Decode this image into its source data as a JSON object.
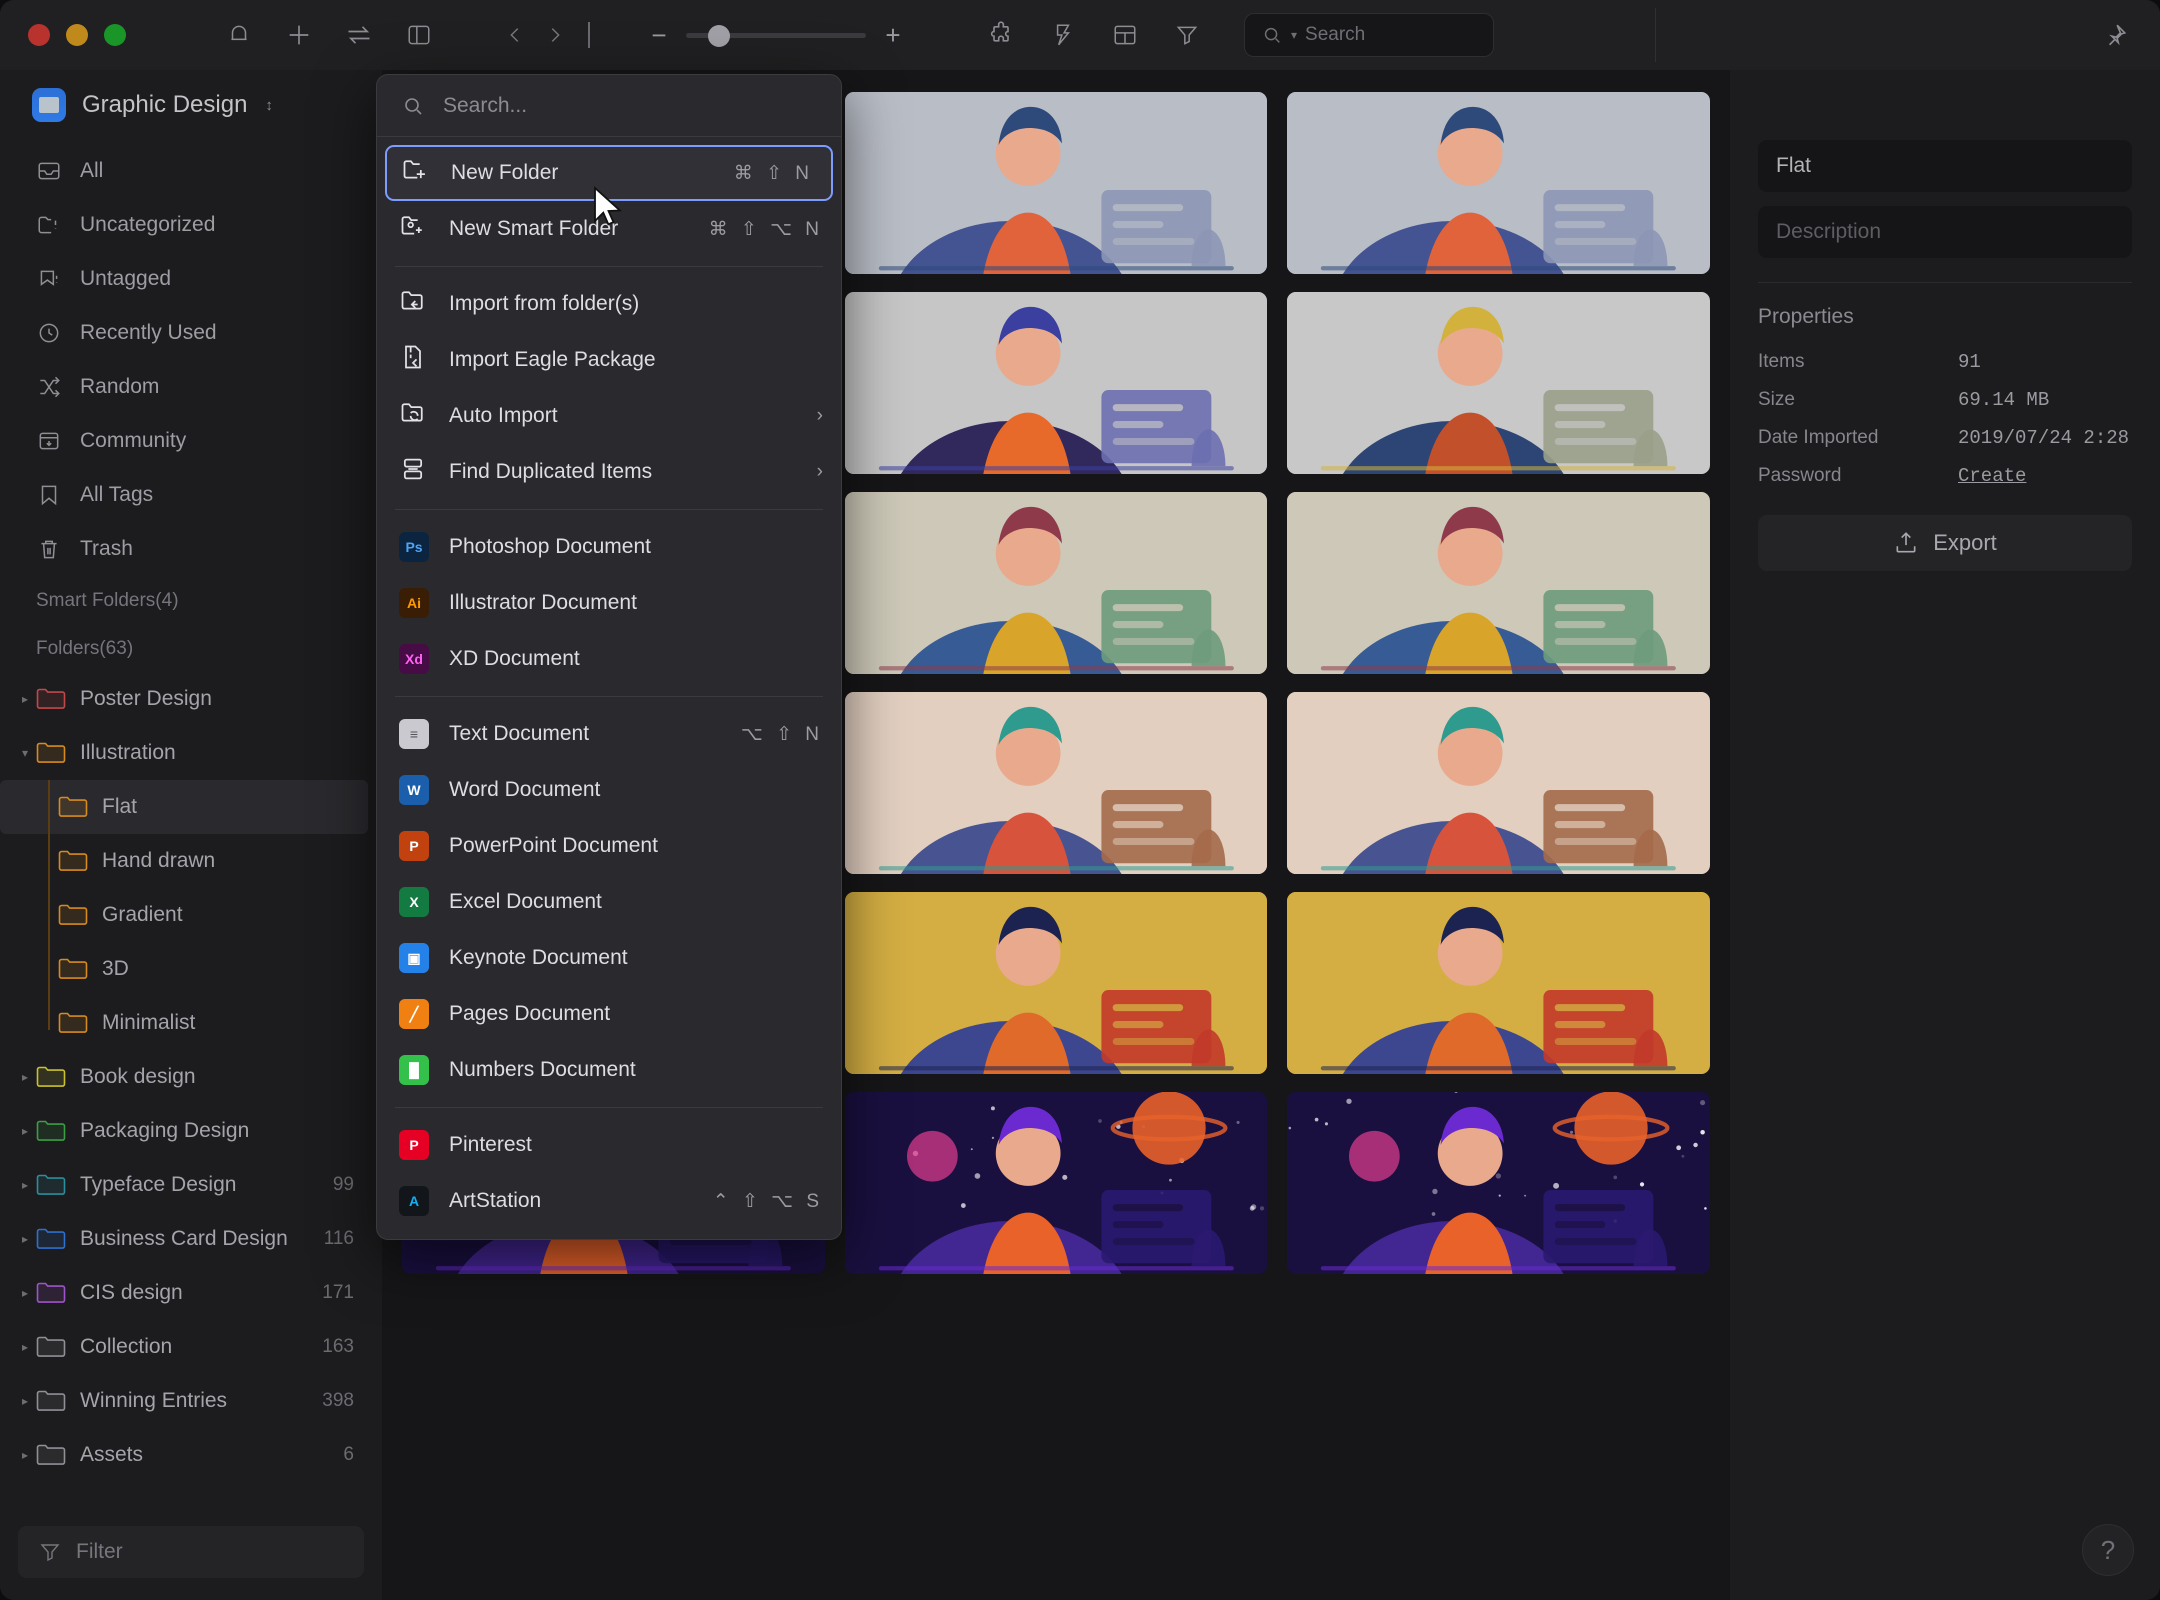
{
  "window": {
    "traffic_lights": [
      "close",
      "minimize",
      "zoom"
    ],
    "toolbar_icons": [
      "bell-icon",
      "plus-icon",
      "transfer-icon",
      "sidebar-toggle-icon"
    ],
    "nav_back": "‹",
    "nav_forward": "›",
    "zoom_minus": "−",
    "zoom_plus": "+",
    "tool_icons": [
      "puzzle-icon",
      "lightning-icon",
      "layout-icon",
      "filter-icon"
    ],
    "search": {
      "placeholder": "Search",
      "value": ""
    },
    "pin": "pin-icon"
  },
  "sidebar": {
    "library": {
      "name": "Graphic Design",
      "chevron": "⌃⌄"
    },
    "nav_items": [
      {
        "label": "All",
        "icon": "inbox-icon"
      },
      {
        "label": "Uncategorized",
        "icon": "folder-question-icon"
      },
      {
        "label": "Untagged",
        "icon": "tag-question-icon"
      },
      {
        "label": "Recently Used",
        "icon": "clock-icon"
      },
      {
        "label": "Random",
        "icon": "shuffle-icon"
      },
      {
        "label": "Community",
        "icon": "community-icon"
      },
      {
        "label": "All Tags",
        "icon": "bookmark-icon"
      },
      {
        "label": "Trash",
        "icon": "trash-icon"
      }
    ],
    "smart_folders_label": "Smart Folders(4)",
    "folders_label": "Folders(63)",
    "folders": [
      {
        "label": "Poster Design",
        "color": "#c2484a",
        "count": "",
        "level": 0,
        "disc": "collapsed",
        "selected": false
      },
      {
        "label": "Illustration",
        "color": "#d78a1e",
        "count": "",
        "level": 0,
        "disc": "expanded",
        "selected": false
      },
      {
        "label": "Flat",
        "color": "#d78a1e",
        "count": "",
        "level": 1,
        "disc": "none",
        "selected": true
      },
      {
        "label": "Hand drawn",
        "color": "#d78a1e",
        "count": "",
        "level": 1,
        "disc": "none",
        "selected": false
      },
      {
        "label": "Gradient",
        "color": "#d78a1e",
        "count": "",
        "level": 1,
        "disc": "none",
        "selected": false
      },
      {
        "label": "3D",
        "color": "#d78a1e",
        "count": "",
        "level": 1,
        "disc": "none",
        "selected": false
      },
      {
        "label": "Minimalist",
        "color": "#d78a1e",
        "count": "",
        "level": 1,
        "disc": "none",
        "selected": false
      },
      {
        "label": "Book design",
        "color": "#c9c22c",
        "count": "",
        "level": 0,
        "disc": "collapsed",
        "selected": false
      },
      {
        "label": "Packaging Design",
        "color": "#3a9e44",
        "count": "",
        "level": 0,
        "disc": "collapsed",
        "selected": false
      },
      {
        "label": "Typeface Design",
        "color": "#2c8d9e",
        "count": "99",
        "level": 0,
        "disc": "collapsed",
        "selected": false
      },
      {
        "label": "Business Card Design",
        "color": "#2f6fd0",
        "count": "116",
        "level": 0,
        "disc": "collapsed",
        "selected": false
      },
      {
        "label": "CIS design",
        "color": "#9e54c9",
        "count": "171",
        "level": 0,
        "disc": "collapsed",
        "selected": false
      },
      {
        "label": "Collection",
        "color": "#8f8f95",
        "count": "163",
        "level": 0,
        "disc": "collapsed",
        "selected": false
      },
      {
        "label": "Winning Entries",
        "color": "#8f8f95",
        "count": "398",
        "level": 0,
        "disc": "collapsed",
        "selected": false
      },
      {
        "label": "Assets",
        "color": "#8f8f95",
        "count": "6",
        "level": 0,
        "disc": "collapsed",
        "selected": false
      }
    ],
    "filter": {
      "placeholder": "Filter",
      "icon": "filter-icon"
    }
  },
  "context_menu": {
    "search_placeholder": "Search...",
    "groups": [
      {
        "items": [
          {
            "label": "New Folder",
            "icon": "new-folder-icon",
            "shortcut": "⌘ ⇧ N",
            "highlighted": true
          },
          {
            "label": "New Smart Folder",
            "icon": "new-smart-folder-icon",
            "shortcut": "⌘ ⇧ ⌥ N",
            "highlighted": false
          }
        ]
      },
      {
        "items": [
          {
            "label": "Import from folder(s)",
            "icon": "import-folder-icon",
            "shortcut": "",
            "submenu": false
          },
          {
            "label": "Import Eagle Package",
            "icon": "import-package-icon",
            "shortcut": "",
            "submenu": false
          },
          {
            "label": "Auto Import",
            "icon": "auto-import-icon",
            "shortcut": "",
            "submenu": true
          },
          {
            "label": "Find Duplicated Items",
            "icon": "find-duplicates-icon",
            "shortcut": "",
            "submenu": true
          }
        ]
      },
      {
        "items": [
          {
            "label": "Photoshop Document",
            "icon": "photoshop-icon",
            "badge": "Ps",
            "bg": "#0b243f",
            "fg": "#4ea3f5",
            "shortcut": ""
          },
          {
            "label": "Illustrator Document",
            "icon": "illustrator-icon",
            "badge": "Ai",
            "bg": "#3a1d05",
            "fg": "#ff9a00",
            "shortcut": ""
          },
          {
            "label": "XD Document",
            "icon": "xd-icon",
            "badge": "Xd",
            "bg": "#470b45",
            "fg": "#ff61f6",
            "shortcut": ""
          }
        ]
      },
      {
        "items": [
          {
            "label": "Text Document",
            "icon": "text-document-icon",
            "badge": "≡",
            "bg": "#c9c9cf",
            "fg": "#55555b",
            "shortcut": "⌥ ⇧ N"
          },
          {
            "label": "Word Document",
            "icon": "word-icon",
            "badge": "W",
            "bg": "#1b5eab",
            "fg": "#ffffff",
            "shortcut": ""
          },
          {
            "label": "PowerPoint Document",
            "icon": "powerpoint-icon",
            "badge": "P",
            "bg": "#c1420f",
            "fg": "#ffffff",
            "shortcut": ""
          },
          {
            "label": "Excel Document",
            "icon": "excel-icon",
            "badge": "X",
            "bg": "#137a42",
            "fg": "#ffffff",
            "shortcut": ""
          },
          {
            "label": "Keynote Document",
            "icon": "keynote-icon",
            "badge": "▣",
            "bg": "#2481e8",
            "fg": "#ffffff",
            "shortcut": ""
          },
          {
            "label": "Pages Document",
            "icon": "pages-icon",
            "badge": "╱",
            "bg": "#f08012",
            "fg": "#ffffff",
            "shortcut": ""
          },
          {
            "label": "Numbers Document",
            "icon": "numbers-icon",
            "badge": "█",
            "bg": "#34c14b",
            "fg": "#ffffff",
            "shortcut": ""
          }
        ]
      },
      {
        "items": [
          {
            "label": "Pinterest",
            "icon": "pinterest-icon",
            "badge": "P",
            "bg": "#e60023",
            "fg": "#ffffff",
            "shortcut": ""
          },
          {
            "label": "ArtStation",
            "icon": "artstation-icon",
            "badge": "A",
            "bg": "#12151a",
            "fg": "#13aff0",
            "shortcut": "⌃ ⇧ ⌥ S"
          }
        ]
      }
    ]
  },
  "inspector": {
    "title_value": "Flat",
    "description_placeholder": "Description",
    "properties_label": "Properties",
    "properties": [
      {
        "key": "Items",
        "value": "91",
        "link": false
      },
      {
        "key": "Size",
        "value": "69.14 MB",
        "link": false
      },
      {
        "key": "Date Imported",
        "value": "2019/07/24 2:28",
        "link": false
      },
      {
        "key": "Password",
        "value": "Create",
        "link": true
      }
    ],
    "export_label": "Export"
  },
  "help": {
    "label": "?"
  },
  "grid": {
    "selected_index": 12,
    "items": [
      {
        "name": "illustration-woman-desk-chart",
        "bg": "#b9bdc6",
        "theme": "light-blue"
      },
      {
        "name": "illustration-woman-laptop-cat",
        "bg": "#b9bdc6",
        "theme": "light-blue"
      },
      {
        "name": "illustration-person-phone-sofa",
        "bg": "#c3c6cd",
        "theme": "light-blue"
      },
      {
        "name": "illustration-person-reading-lamp",
        "bg": "#b9bdc6",
        "theme": "light-blue"
      },
      {
        "name": "illustration-father-child-telescope",
        "bg": "#c6c6c6",
        "theme": "space"
      },
      {
        "name": "illustration-man-fishing-cat",
        "bg": "#c8c8c8",
        "theme": "light-grey"
      },
      {
        "name": "illustration-person-plants",
        "bg": "#cdc8b8",
        "theme": "beige"
      },
      {
        "name": "illustration-gardener-watering-cat",
        "bg": "#cdc8b8",
        "theme": "beige"
      },
      {
        "name": "illustration-man-reading-book-coffee",
        "bg": "#cdc8b8",
        "theme": "beige"
      },
      {
        "name": "illustration-couple-kitchen",
        "bg": "#e2cfc0",
        "theme": "peach"
      },
      {
        "name": "illustration-man-child-lamp",
        "bg": "#e2cfc0",
        "theme": "peach"
      },
      {
        "name": "illustration-woman-laptop-plant",
        "bg": "#e2cfc0",
        "theme": "peach"
      },
      {
        "name": "illustration-couple-sleeping",
        "bg": "#c9a22a",
        "theme": "gold"
      },
      {
        "name": "illustration-old-man-armchair-pipe",
        "bg": "#d4ae43",
        "theme": "gold"
      },
      {
        "name": "illustration-bus-stop-people",
        "bg": "#d4ae43",
        "theme": "gold"
      },
      {
        "name": "illustration-night-laptop-books",
        "bg": "#1a1040",
        "theme": "night"
      },
      {
        "name": "illustration-space-planets",
        "bg": "#1a1040",
        "theme": "night"
      },
      {
        "name": "illustration-woman-purple-leaves",
        "bg": "#1a1040",
        "theme": "night"
      }
    ]
  }
}
